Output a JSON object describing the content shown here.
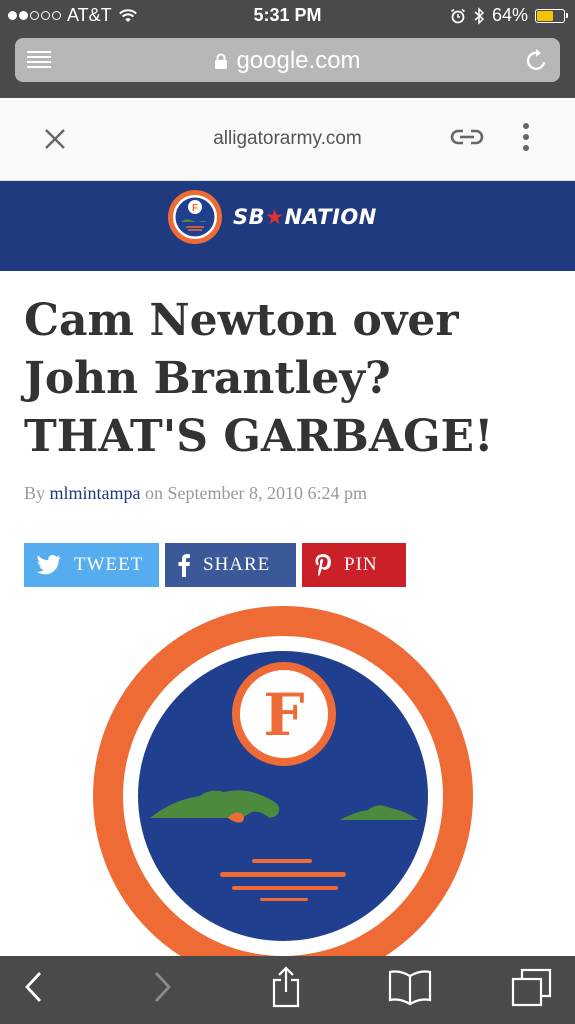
{
  "status_bar": {
    "carrier": "AT&T",
    "signal_bars_filled": 2,
    "signal_bars_total": 5,
    "time": "5:31 PM",
    "battery_percent": "64%",
    "battery_level": 0.64,
    "battery_color": "#f5c400"
  },
  "url_bar": {
    "domain": "google.com",
    "icons": [
      "menu-icon",
      "lock-icon",
      "reload-icon"
    ]
  },
  "amp_header": {
    "domain": "alligatorarmy.com",
    "icons": [
      "close-icon",
      "link-icon",
      "more-icon"
    ]
  },
  "banner": {
    "brand_left": "SB",
    "brand_right": "NATION",
    "bg_color": "#203a7f"
  },
  "article": {
    "headline": "Cam Newton over John Brantley? THAT'S GARBAGE!",
    "byline_prefix": "By",
    "author": "mlmintampa",
    "byline_on": "on",
    "date": "September 8, 2010 6:24 pm"
  },
  "share": {
    "tweet": "TWEET",
    "share": "SHARE",
    "pin": "PIN",
    "colors": {
      "twitter": "#55acee",
      "facebook": "#3b5998",
      "pinterest": "#cb2027"
    }
  },
  "logo": {
    "letter": "F",
    "colors": {
      "ring": "#ef6b35",
      "field": "#213f8f",
      "gator": "#4c8b3d"
    }
  },
  "toolbar": {
    "icons": [
      "back-icon",
      "forward-icon",
      "share-icon",
      "bookmarks-icon",
      "tabs-icon"
    ]
  }
}
